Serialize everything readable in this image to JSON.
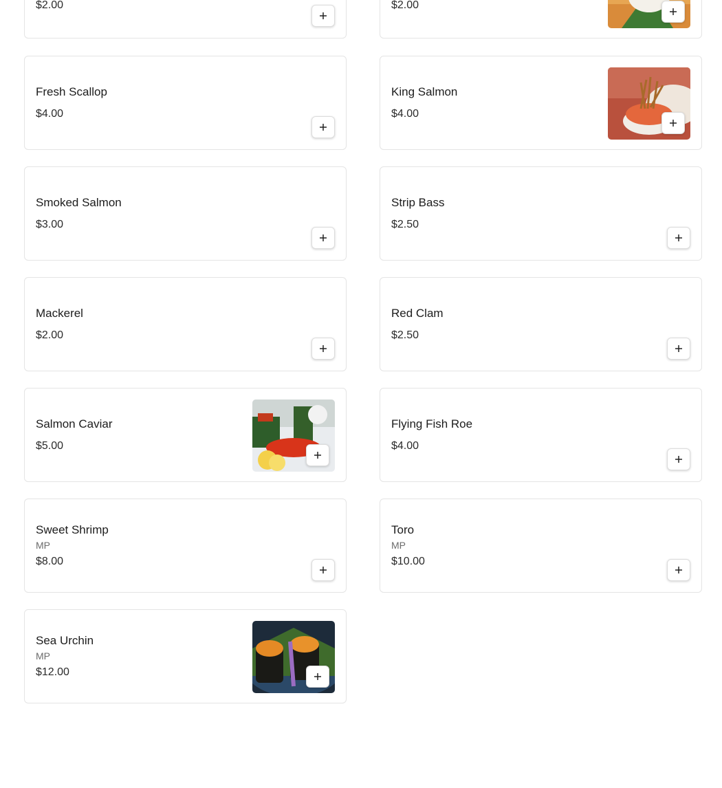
{
  "menu_items": [
    {
      "name": "",
      "price": "$2.00"
    },
    {
      "name": "",
      "price": "$2.00"
    },
    {
      "name": "Fresh Scallop",
      "price": "$4.00"
    },
    {
      "name": "King Salmon",
      "price": "$4.00"
    },
    {
      "name": "Smoked Salmon",
      "price": "$3.00"
    },
    {
      "name": "Strip Bass",
      "price": "$2.50"
    },
    {
      "name": "Mackerel",
      "price": "$2.00"
    },
    {
      "name": "Red Clam",
      "price": "$2.50"
    },
    {
      "name": "Salmon Caviar",
      "price": "$5.00"
    },
    {
      "name": "Flying Fish Roe",
      "price": "$4.00"
    },
    {
      "name": "Sweet Shrimp",
      "note": "MP",
      "price": "$8.00"
    },
    {
      "name": "Toro",
      "note": "MP",
      "price": "$10.00"
    },
    {
      "name": "Sea Urchin",
      "note": "MP",
      "price": "$12.00"
    }
  ],
  "icons": {
    "add": "plus-icon"
  }
}
